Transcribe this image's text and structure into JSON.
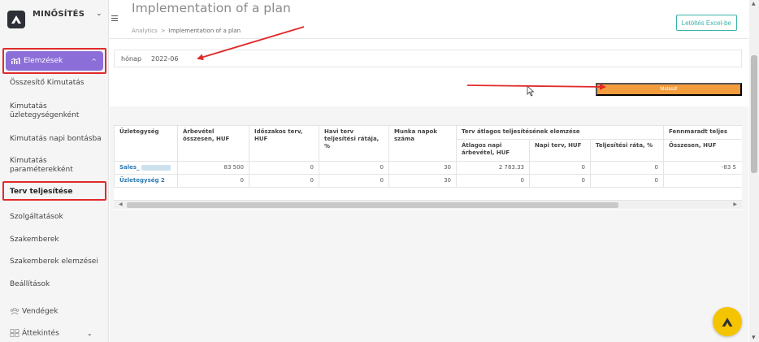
{
  "app": {
    "brand_name": "MINŐSÍTÉS"
  },
  "sidebar": {
    "group_label": "Elemzések",
    "items": [
      {
        "label": "Összesítő Kimutatás"
      },
      {
        "label": "Kimutatás üzletegységenként"
      },
      {
        "label": "Kimutatás napi bontásba"
      },
      {
        "label": "Kimutatás paraméterekként"
      },
      {
        "label": "Terv teljesítése"
      },
      {
        "label": "Szolgáltatások"
      },
      {
        "label": "Szakemberek"
      },
      {
        "label": "Szakemberek elemzései"
      },
      {
        "label": "Beállítások"
      },
      {
        "label": "Vendégek"
      },
      {
        "label": "Áttekintés"
      }
    ]
  },
  "header": {
    "title": "Implementation of a plan",
    "breadcrumb_root": "Analytics",
    "breadcrumb_current": "Implementation of a plan",
    "export_label": "Letöltés Excel-be"
  },
  "filter": {
    "label": "hónap",
    "value": "2022-06"
  },
  "actions": {
    "show_label": "Mutasd!"
  },
  "table": {
    "headers": {
      "unit": "Üzletegység",
      "revenue_total": "Árbevétel összesen, HUF",
      "period_plan": "Időszakos terv, HUF",
      "monthly_plan_rate": "Havi terv teljesítési rátája, %",
      "work_days": "Munka napok száma",
      "avg_analysis_group": "Terv átlagos teljesítésének elemzése",
      "avg_daily_revenue": "Átlagos napi árbevétel, HUF",
      "daily_plan": "Napi terv, HUF",
      "completion_rate": "Teljesítési ráta, %",
      "remaining_group": "Fennmaradt teljes",
      "remaining_total": "Összesen, HUF"
    },
    "rows": [
      {
        "unit": "Sales_",
        "revenue_total": "83 500",
        "period_plan": "0",
        "monthly_plan_rate": "0",
        "work_days": "30",
        "avg_daily_revenue": "2 783.33",
        "daily_plan": "0",
        "completion_rate": "0",
        "remaining_total": "-83 5"
      },
      {
        "unit": "Üzletegység 2",
        "revenue_total": "0",
        "period_plan": "0",
        "monthly_plan_rate": "0",
        "work_days": "30",
        "avg_daily_revenue": "0",
        "daily_plan": "0",
        "completion_rate": "0",
        "remaining_total": ""
      }
    ]
  },
  "colors": {
    "accent_purple": "#8c6ed8",
    "orange": "#f39c3d",
    "teal": "#3ab3a8",
    "annotation_red": "#e12a2a",
    "fab_yellow": "#f5c400"
  }
}
